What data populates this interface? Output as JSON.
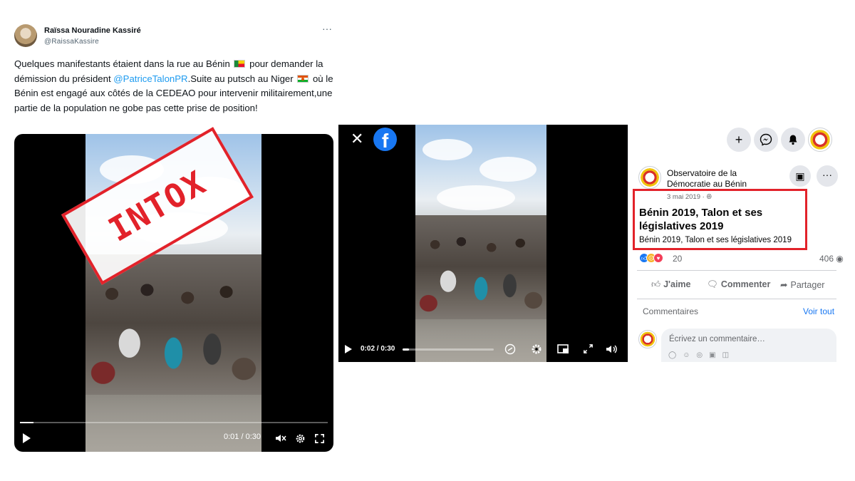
{
  "tweet": {
    "author_name": "Raïssa Nouradine Kassiré",
    "author_handle": "@RaissaKassire",
    "text_part1": "Quelques manifestants étaient dans la rue au Bénin ",
    "text_part2": " pour demander la démission du président ",
    "mention": "@PatriceTalonPR",
    "text_part3": ".Suite au putsch au Niger ",
    "text_part4": " où le Bénin est engagé aux côtés de la CEDEAO pour intervenir militairement,une partie de la population ne gobe pas cette prise de position!",
    "video": {
      "time_display": "0:01 / 0:30",
      "progress_fraction": 0.045
    }
  },
  "stamp": {
    "label": "INTOX",
    "color": "#e2222a"
  },
  "facebook": {
    "video": {
      "time_display": "0:02 / 0:30",
      "progress_fraction": 0.07
    },
    "page_name": "Observatoire de la Démocratie au Bénin",
    "post_date": "3 mai 2019 · ",
    "post_title": "Bénin 2019, Talon et ses législatives 2019",
    "post_description": "Bénin 2019, Talon et ses législatives 2019",
    "reaction_count": "20",
    "view_count": "406",
    "actions": {
      "like": "J'aime",
      "comment": "Commenter",
      "share": "Partager"
    },
    "comments_label": "Commentaires",
    "see_all": "Voir tout",
    "comment_placeholder": "Écrivez un commentaire…",
    "brand_color": "#1877f2"
  }
}
